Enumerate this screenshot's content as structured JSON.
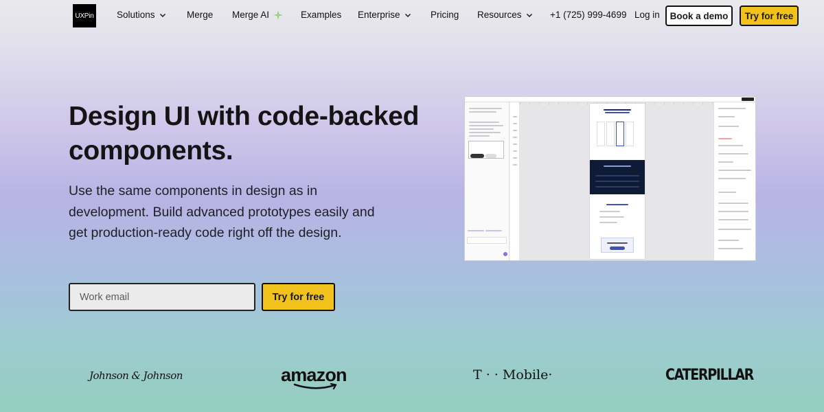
{
  "nav": {
    "logo": "UXPin",
    "items": [
      {
        "label": "Solutions",
        "dropdown": true
      },
      {
        "label": "Merge",
        "dropdown": false
      },
      {
        "label": "Merge AI",
        "dropdown": false,
        "icon": "sparkle-icon"
      },
      {
        "label": "Examples",
        "dropdown": false
      },
      {
        "label": "Enterprise",
        "dropdown": true
      },
      {
        "label": "Pricing",
        "dropdown": false
      },
      {
        "label": "Resources",
        "dropdown": true
      }
    ],
    "phone": "+1 (725) 999-4699",
    "login": "Log in",
    "book_demo": "Book a demo",
    "try_free": "Try for free"
  },
  "hero": {
    "title": "Design UI with code-backed components.",
    "subtitle": "Use the same components in design as in development. Build advanced prototypes easily and get production-ready code right off the design.",
    "email_placeholder": "Work email",
    "cta": "Try for free"
  },
  "logos": [
    "Johnson & Johnson",
    "amazon",
    "T · · Mobile·",
    "CATERPILLAR"
  ],
  "colors": {
    "accent_yellow": "#f1c21b",
    "text_dark": "#141414",
    "mock_dark": "#0f1b36"
  }
}
